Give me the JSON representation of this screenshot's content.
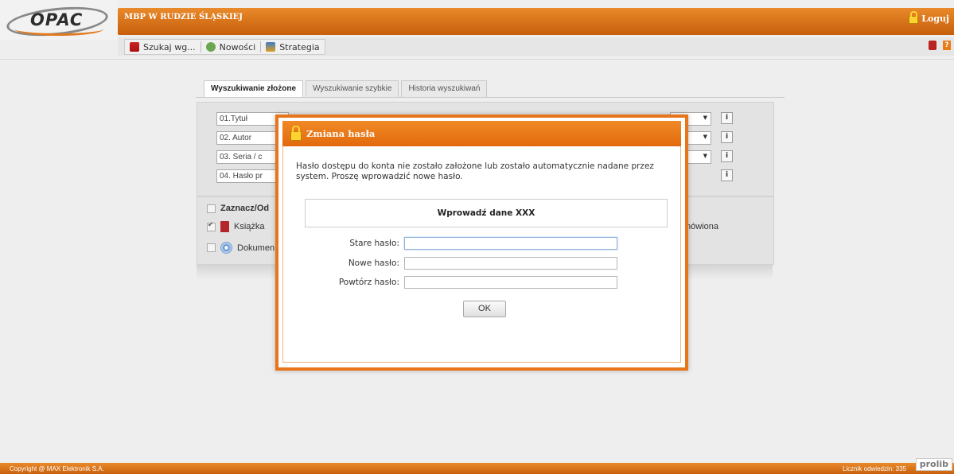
{
  "header": {
    "logo_text": "OPAC",
    "library_name": "MBP W RUDZIE ŚLĄSKIEJ",
    "login_label": "Loguj"
  },
  "menu": {
    "items": [
      {
        "label": "Szukaj wg...",
        "icon": "book-search-icon"
      },
      {
        "label": "Nowości",
        "icon": "news-icon"
      },
      {
        "label": "Strategia",
        "icon": "strategy-icon"
      }
    ]
  },
  "tabs": [
    {
      "label": "Wyszukiwanie złożone",
      "active": true
    },
    {
      "label": "Wyszukiwanie szybkie",
      "active": false
    },
    {
      "label": "Historia wyszukiwań",
      "active": false
    }
  ],
  "search_fields": [
    {
      "label": "01.Tytuł"
    },
    {
      "label": "02. Autor"
    },
    {
      "label": "03. Seria / c"
    },
    {
      "label": "04. Hasło pr"
    }
  ],
  "info_label": "i",
  "filters": {
    "select_all": "Zaznacz/Od",
    "book": "Książka",
    "document": "Dokumen",
    "status_partial": "nówiona"
  },
  "modal": {
    "title": "Zmiana hasła",
    "message": "Hasło dostępu do konta nie zostało założone lub zostało automatycznie nadane przez system. Proszę wprowadzić nowe hasło.",
    "info_box": "Wprowadź dane XXX",
    "fields": [
      {
        "label": "Stare hasło:",
        "value": ""
      },
      {
        "label": "Nowe hasło:",
        "value": ""
      },
      {
        "label": "Powtórz hasło:",
        "value": ""
      }
    ],
    "ok_label": "OK"
  },
  "footer": {
    "copyright": "Copyright @ MAX Elektronik S.A.",
    "counter": "Licznik odwiedzin: 335",
    "brand": "prolib"
  },
  "colors": {
    "accent": "#e8751a"
  }
}
